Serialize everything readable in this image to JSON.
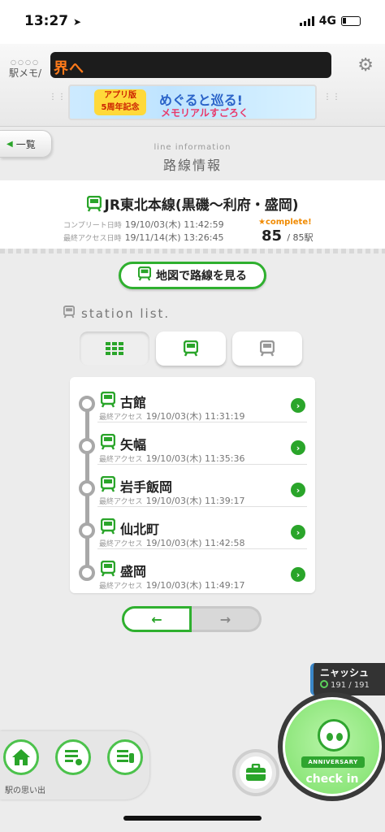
{
  "status": {
    "time": "13:27",
    "network": "4G"
  },
  "header": {
    "logo": "駅メモ/",
    "ticker": "界へ",
    "banner": {
      "badge_line1": "アプリ版",
      "badge_line2": "5周年記念",
      "title": "めぐると巡る!",
      "subtitle": "メモリアルすごろく"
    }
  },
  "nav": {
    "back_label": "一覧"
  },
  "page": {
    "subtitle": "line information",
    "title": "路線情報"
  },
  "line": {
    "name": "JR東北本線(黒磯〜利府・盛岡)",
    "complete_label": "コンプリート日時",
    "complete_date": "19/10/03(木) 11:42:59",
    "access_label": "最終アクセス日時",
    "access_date": "19/11/14(木) 13:26:45",
    "complete_tag": "★complete!",
    "count": "85",
    "total": "/ 85駅"
  },
  "actions": {
    "map_button": "地図で路線を見る"
  },
  "station_list": {
    "section_label": "station list.",
    "access_label": "最終アクセス",
    "items": [
      {
        "name": "古館",
        "access": "19/10/03(木) 11:31:19"
      },
      {
        "name": "矢幅",
        "access": "19/10/03(木) 11:35:36"
      },
      {
        "name": "岩手飯岡",
        "access": "19/10/03(木) 11:39:17"
      },
      {
        "name": "仙北町",
        "access": "19/10/03(木) 11:42:58"
      },
      {
        "name": "盛岡",
        "access": "19/10/03(木) 11:49:17"
      }
    ]
  },
  "pager": {
    "prev": "←",
    "next": "→"
  },
  "user": {
    "name": "ニャッシュ",
    "count": "191 / 191"
  },
  "bottom": {
    "label": "駅の思い出"
  },
  "checkin": {
    "anniversary": "ANNIVERSARY",
    "label": "check in"
  },
  "colors": {
    "accent": "#2fb02f",
    "ticker_text": "#ff7a1a",
    "complete": "#f08a00"
  },
  "icons": [
    "location-arrow-icon",
    "gear-icon",
    "train-icon",
    "grid-icon",
    "chevron-right-icon",
    "home-icon",
    "list-icon",
    "briefcase-icon"
  ]
}
